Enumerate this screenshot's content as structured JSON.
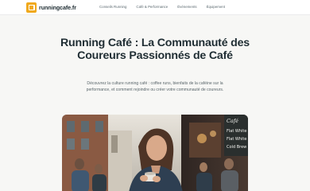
{
  "header": {
    "logo_text": "runningcafe.fr",
    "logo_icon": "coffee-cup-icon",
    "nav": [
      {
        "label": "Conseils Running"
      },
      {
        "label": "Café & Performance"
      },
      {
        "label": "Événements"
      },
      {
        "label": "Équipement"
      }
    ]
  },
  "hero": {
    "title": "Running Café : La Communauté des Coureurs Passionnés de Café",
    "description": "Découvrez la culture running café : coffee runs, bienfaits de la caféine sur la performance, et comment rejoindre ou créer votre communauté de coureurs."
  },
  "photo": {
    "chalkboard_text": [
      "Café",
      "Flat White",
      "Flat White",
      "Cold Brew"
    ]
  },
  "colors": {
    "accent": "#f0a91c",
    "background": "#f7f7f5",
    "text": "#1f2d33"
  }
}
